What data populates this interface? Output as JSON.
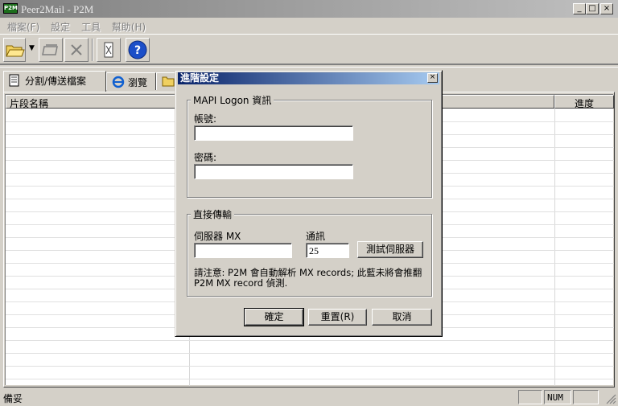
{
  "window": {
    "app_icon": "P2M",
    "title": "Peer2Mail - P2M",
    "minimize": "_",
    "maximize": "□",
    "close": "×"
  },
  "menu": [
    "檔案(F)",
    "設定",
    "工具",
    "幫助(H)"
  ],
  "toolbar": {
    "icons": [
      "open-folder-icon",
      "dropdown-arrow-icon",
      "open-file-icon",
      "delete-icon",
      "split-icon",
      "help-icon"
    ]
  },
  "tabs": [
    {
      "label": "分割/傳送檔案",
      "icon": "document-icon"
    },
    {
      "label": "瀏覽",
      "icon": "ie-browser-icon"
    },
    {
      "label": "",
      "icon": "folder-icon"
    }
  ],
  "list": {
    "columns": [
      "片段名稱",
      "進度"
    ]
  },
  "status": {
    "text": "備妥",
    "num": "NUM"
  },
  "dialog": {
    "title": "進階設定",
    "close": "×",
    "mapi_group": "MAPI Logon 資訊",
    "account_label": "帳號:",
    "account_value": "",
    "password_label": "密碼:",
    "password_value": "",
    "direct_group": "直接傳輸",
    "server_label": "伺服器 MX",
    "server_value": "",
    "port_label": "通訊",
    "port_value": "25",
    "test_button": "測試伺服器",
    "note": "請注意: P2M 會自動解析 MX records; 此藍未將會推翻 P2M MX record 偵測.",
    "ok_button": "確定",
    "reset_button": "重置(R)",
    "cancel_button": "取消"
  }
}
